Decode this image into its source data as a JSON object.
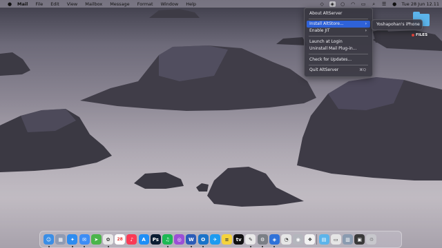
{
  "menubar": {
    "apple_icon": "apple-logo-icon",
    "app_name": "Mail",
    "items": [
      "File",
      "Edit",
      "View",
      "Mailbox",
      "Message",
      "Format",
      "Window",
      "Help"
    ],
    "status_icons": [
      "diamond-icon",
      "altserver-icon",
      "circle-icon",
      "wifi-icon",
      "battery-icon",
      "search-icon",
      "control-center-icon",
      "siri-icon"
    ],
    "clock": "Tue 28 Jun  12.11"
  },
  "altserver_menu": {
    "items": [
      {
        "label": "About AltServer"
      },
      {
        "label": "Install AltStore...",
        "has_submenu": true,
        "highlighted": true
      },
      {
        "label": "Enable JIT",
        "has_submenu": true
      },
      {
        "label": "Launch at Login"
      },
      {
        "label": "Uninstall Mail Plug-in..."
      },
      {
        "label": "Check for Updates..."
      },
      {
        "label": "Quit AltServer",
        "shortcut": "⌘Q"
      }
    ],
    "submenu": {
      "items": [
        "Yoshapohan's iPhone"
      ]
    }
  },
  "desktop": {
    "folder_label": "FILES",
    "folder_tag_color": "#e6453c"
  },
  "dock": {
    "apps": [
      {
        "name": "finder",
        "glyph": "☺",
        "color": "#3a8ee6"
      },
      {
        "name": "launchpad",
        "glyph": "▦",
        "color": "#8f9bb3"
      },
      {
        "name": "safari",
        "glyph": "✦",
        "color": "#2d8cf0"
      },
      {
        "name": "mail",
        "glyph": "✉",
        "color": "#3d8df5"
      },
      {
        "name": "maps",
        "glyph": "➤",
        "color": "#4bb54a"
      },
      {
        "name": "photos",
        "glyph": "✿",
        "color": "#e8e8e8"
      },
      {
        "name": "calendar",
        "glyph": "28",
        "color": "#ffffff"
      },
      {
        "name": "music",
        "glyph": "♪",
        "color": "#fa3a55"
      },
      {
        "name": "app-store",
        "glyph": "A",
        "color": "#1e8ef6"
      },
      {
        "name": "photoshop",
        "glyph": "Ps",
        "color": "#0b1d33"
      },
      {
        "name": "spotify",
        "glyph": "♫",
        "color": "#1db954"
      },
      {
        "name": "podcasts",
        "glyph": "◎",
        "color": "#9b4fd6"
      },
      {
        "name": "word",
        "glyph": "W",
        "color": "#2b5cb7"
      },
      {
        "name": "outlook",
        "glyph": "O",
        "color": "#1a73c9"
      },
      {
        "name": "twitter",
        "glyph": "✈",
        "color": "#1d9bf0"
      },
      {
        "name": "notes",
        "glyph": "≡",
        "color": "#f5d33c"
      },
      {
        "name": "apple-tv",
        "glyph": "tv",
        "color": "#111111"
      },
      {
        "name": "messages",
        "glyph": "✎",
        "color": "#e9e9e9"
      },
      {
        "name": "system-preferences",
        "glyph": "⚙",
        "color": "#7b7f86"
      },
      {
        "name": "altserver",
        "glyph": "◈",
        "color": "#2f72d8"
      },
      {
        "name": "activity-monitor",
        "glyph": "◔",
        "color": "#e6e6e6"
      },
      {
        "name": "network-radar",
        "glyph": "◉",
        "color": "#b4b6bd"
      },
      {
        "name": "clipboard-app",
        "glyph": "❖",
        "color": "#f2f2f2"
      },
      {
        "name": "downloads-folder",
        "glyph": "▤",
        "color": "#5cb4ea"
      },
      {
        "name": "screenshot-app",
        "glyph": "▭",
        "color": "#e5e5e5"
      },
      {
        "name": "display-manager",
        "glyph": "▥",
        "color": "#8a9bb0"
      },
      {
        "name": "camera-app",
        "glyph": "▣",
        "color": "#3a3a3a"
      },
      {
        "name": "trash",
        "glyph": "♲",
        "color": "#c7c7cc"
      }
    ]
  },
  "colors": {
    "menu_highlight": "#2f62d8",
    "menu_background": "#3a3842"
  }
}
